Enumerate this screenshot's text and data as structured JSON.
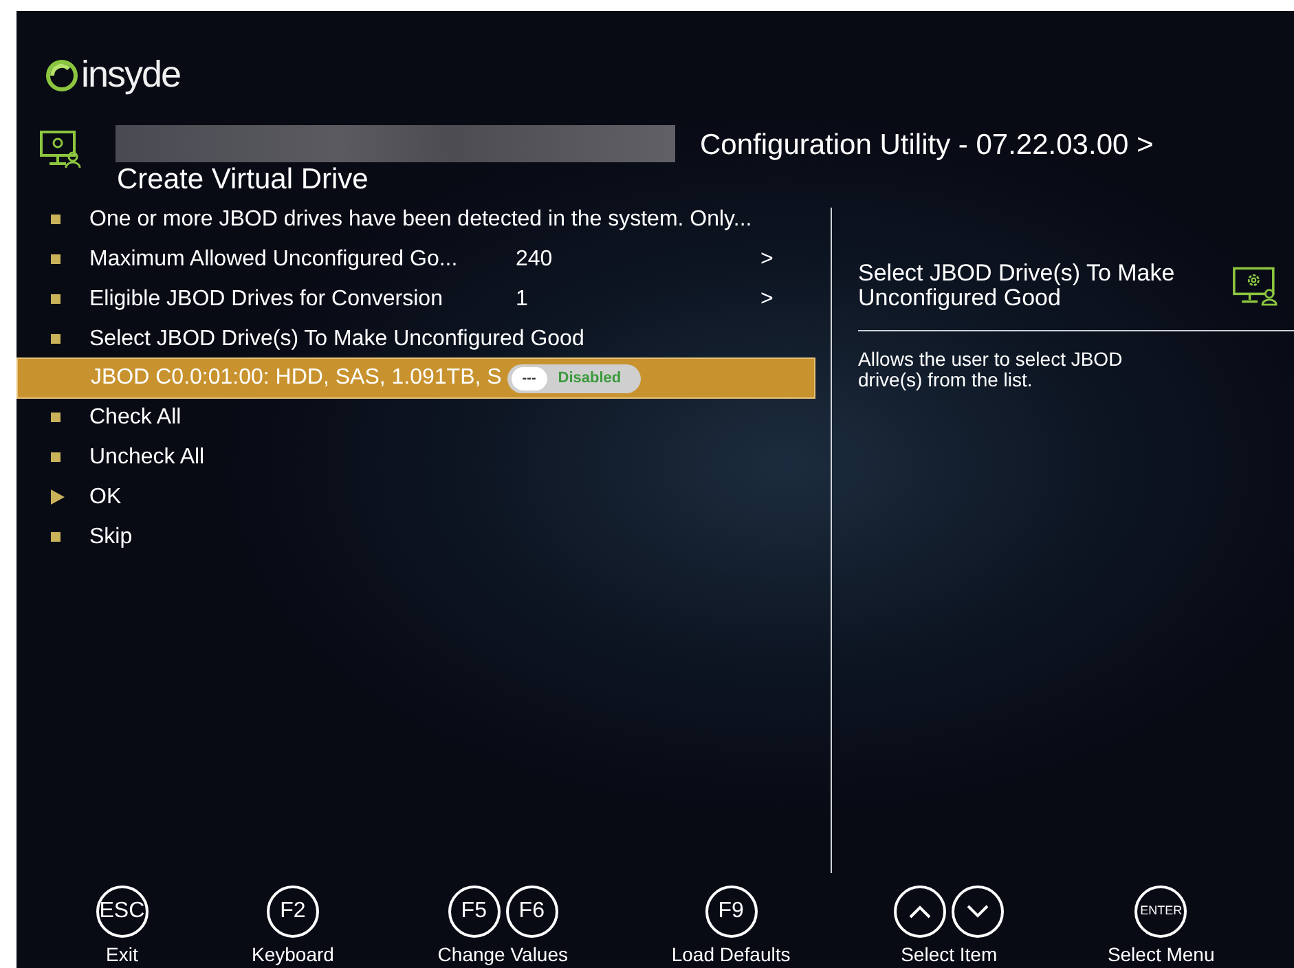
{
  "logo": {
    "text": "insyde"
  },
  "header": {
    "title": "Configuration Utility - 07.22.03.00 >",
    "subtitle": "Create Virtual Drive"
  },
  "menu": [
    {
      "kind": "text",
      "label": "One or more JBOD drives have been detected in the system. Only...",
      "selected": false
    },
    {
      "kind": "setting",
      "label": "Maximum Allowed Unconfigured Go...",
      "value": "240",
      "arrow": ">",
      "selected": false
    },
    {
      "kind": "setting",
      "label": "Eligible JBOD Drives for Conversion",
      "value": "1",
      "arrow": ">",
      "selected": false
    },
    {
      "kind": "text",
      "label": "Select JBOD Drive(s) To Make Unconfigured Good",
      "selected": false
    },
    {
      "kind": "toggle",
      "label": "JBOD C0.0:01:00: HDD, SAS, 1.091TB, S",
      "knob": "---",
      "state_label": "Disabled",
      "on": false,
      "selected": true
    },
    {
      "kind": "text",
      "label": "Check All",
      "selected": false
    },
    {
      "kind": "text",
      "label": "Uncheck All",
      "selected": false
    },
    {
      "kind": "action",
      "label": "OK",
      "selected": false
    },
    {
      "kind": "text",
      "label": "Skip",
      "selected": false
    }
  ],
  "help": {
    "title": "Select JBOD Drive(s) To Make Unconfigured Good",
    "text": "Allows the user to select JBOD drive(s) from the list."
  },
  "footer": [
    {
      "keys": [
        {
          "kind": "text",
          "label": "ESC"
        }
      ],
      "caption": "Exit"
    },
    {
      "keys": [
        {
          "kind": "text",
          "label": "F2"
        }
      ],
      "caption": "Keyboard"
    },
    {
      "keys": [
        {
          "kind": "text",
          "label": "F5"
        },
        {
          "kind": "text",
          "label": "F6"
        }
      ],
      "caption": "Change Values"
    },
    {
      "keys": [
        {
          "kind": "text",
          "label": "F9"
        }
      ],
      "caption": "Load Defaults"
    },
    {
      "keys": [
        {
          "kind": "up"
        },
        {
          "kind": "down"
        }
      ],
      "caption": "Select Item"
    },
    {
      "keys": [
        {
          "kind": "text",
          "label": "ENTER"
        }
      ],
      "caption": "Select Menu"
    }
  ]
}
